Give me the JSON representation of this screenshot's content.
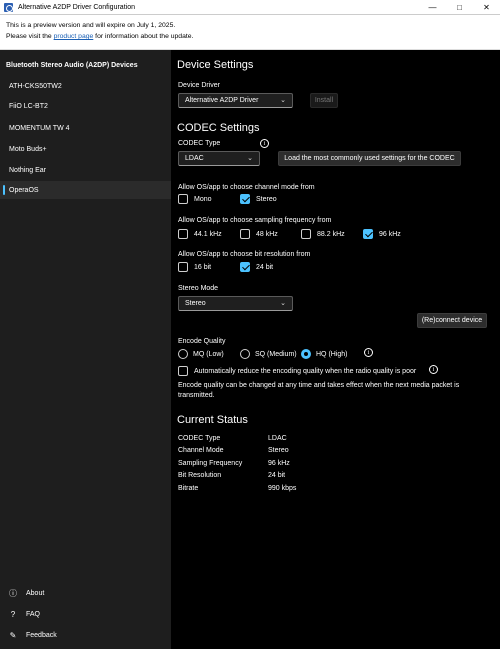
{
  "window": {
    "title": "Alternative A2DP Driver Configuration"
  },
  "banner": {
    "line1": "This is a preview version and will expire on July 1, 2025.",
    "line2_before": "Please visit the ",
    "line2_link": "product page",
    "line2_after": " for information about the update."
  },
  "sidebar": {
    "heading": "Bluetooth Stereo Audio (A2DP) Devices",
    "devices": [
      {
        "label": "ATH-CKS50TW2"
      },
      {
        "label": "FiiO LC-BT2"
      },
      {
        "label": "MOMENTUM TW 4"
      },
      {
        "label": "Moto Buds+"
      },
      {
        "label": "Nothing Ear"
      },
      {
        "label": "OperaOS"
      }
    ],
    "selected_device": "OperaOS",
    "bottom": [
      {
        "label": "About",
        "icon": "info-icon"
      },
      {
        "label": "FAQ",
        "icon": "question-icon"
      },
      {
        "label": "Feedback",
        "icon": "feedback-icon"
      }
    ]
  },
  "device_settings": {
    "title": "Device Settings",
    "driver_label": "Device Driver",
    "driver_value": "Alternative A2DP Driver",
    "install_label": "Install"
  },
  "codec": {
    "title": "CODEC Settings",
    "type_label": "CODEC Type",
    "type_value": "LDAC",
    "load_button": "Load the most commonly used settings for the CODEC",
    "channel_label": "Allow OS/app to choose channel mode from",
    "channel_options": [
      {
        "label": "Mono",
        "checked": false
      },
      {
        "label": "Stereo",
        "checked": true
      }
    ],
    "freq_label": "Allow OS/app to choose sampling frequency from",
    "freq_options": [
      {
        "label": "44.1 kHz",
        "checked": false
      },
      {
        "label": "48 kHz",
        "checked": false
      },
      {
        "label": "88.2 kHz",
        "checked": false
      },
      {
        "label": "96 kHz",
        "checked": true
      }
    ],
    "bits_label": "Allow OS/app to choose bit resolution from",
    "bits_options": [
      {
        "label": "16 bit",
        "checked": false
      },
      {
        "label": "24 bit",
        "checked": true
      }
    ],
    "stereo_label": "Stereo Mode",
    "stereo_value": "Stereo",
    "reconnect_button": "(Re)connect device",
    "quality_label": "Encode Quality",
    "quality_options": [
      {
        "label": "MQ (Low)",
        "selected": false
      },
      {
        "label": "SQ (Medium)",
        "selected": false
      },
      {
        "label": "HQ (High)",
        "selected": true
      }
    ],
    "auto_reduce_label": "Automatically reduce the encoding quality when the radio quality is poor",
    "auto_reduce_checked": false,
    "note_line1": "Encode quality can be changed at any time and takes effect when the next media packet is",
    "note_line2": "transmitted."
  },
  "status": {
    "title": "Current Status",
    "rows": [
      {
        "key": "CODEC Type",
        "value": "LDAC"
      },
      {
        "key": "Channel Mode",
        "value": "Stereo"
      },
      {
        "key": "Sampling Frequency",
        "value": "96 kHz"
      },
      {
        "key": "Bit Resolution",
        "value": "24 bit"
      },
      {
        "key": "Bitrate",
        "value": "990 kbps"
      }
    ]
  },
  "colors": {
    "accent": "#4cc2ff",
    "sidebar_bg": "#1e1e1e",
    "main_bg": "#000000"
  }
}
